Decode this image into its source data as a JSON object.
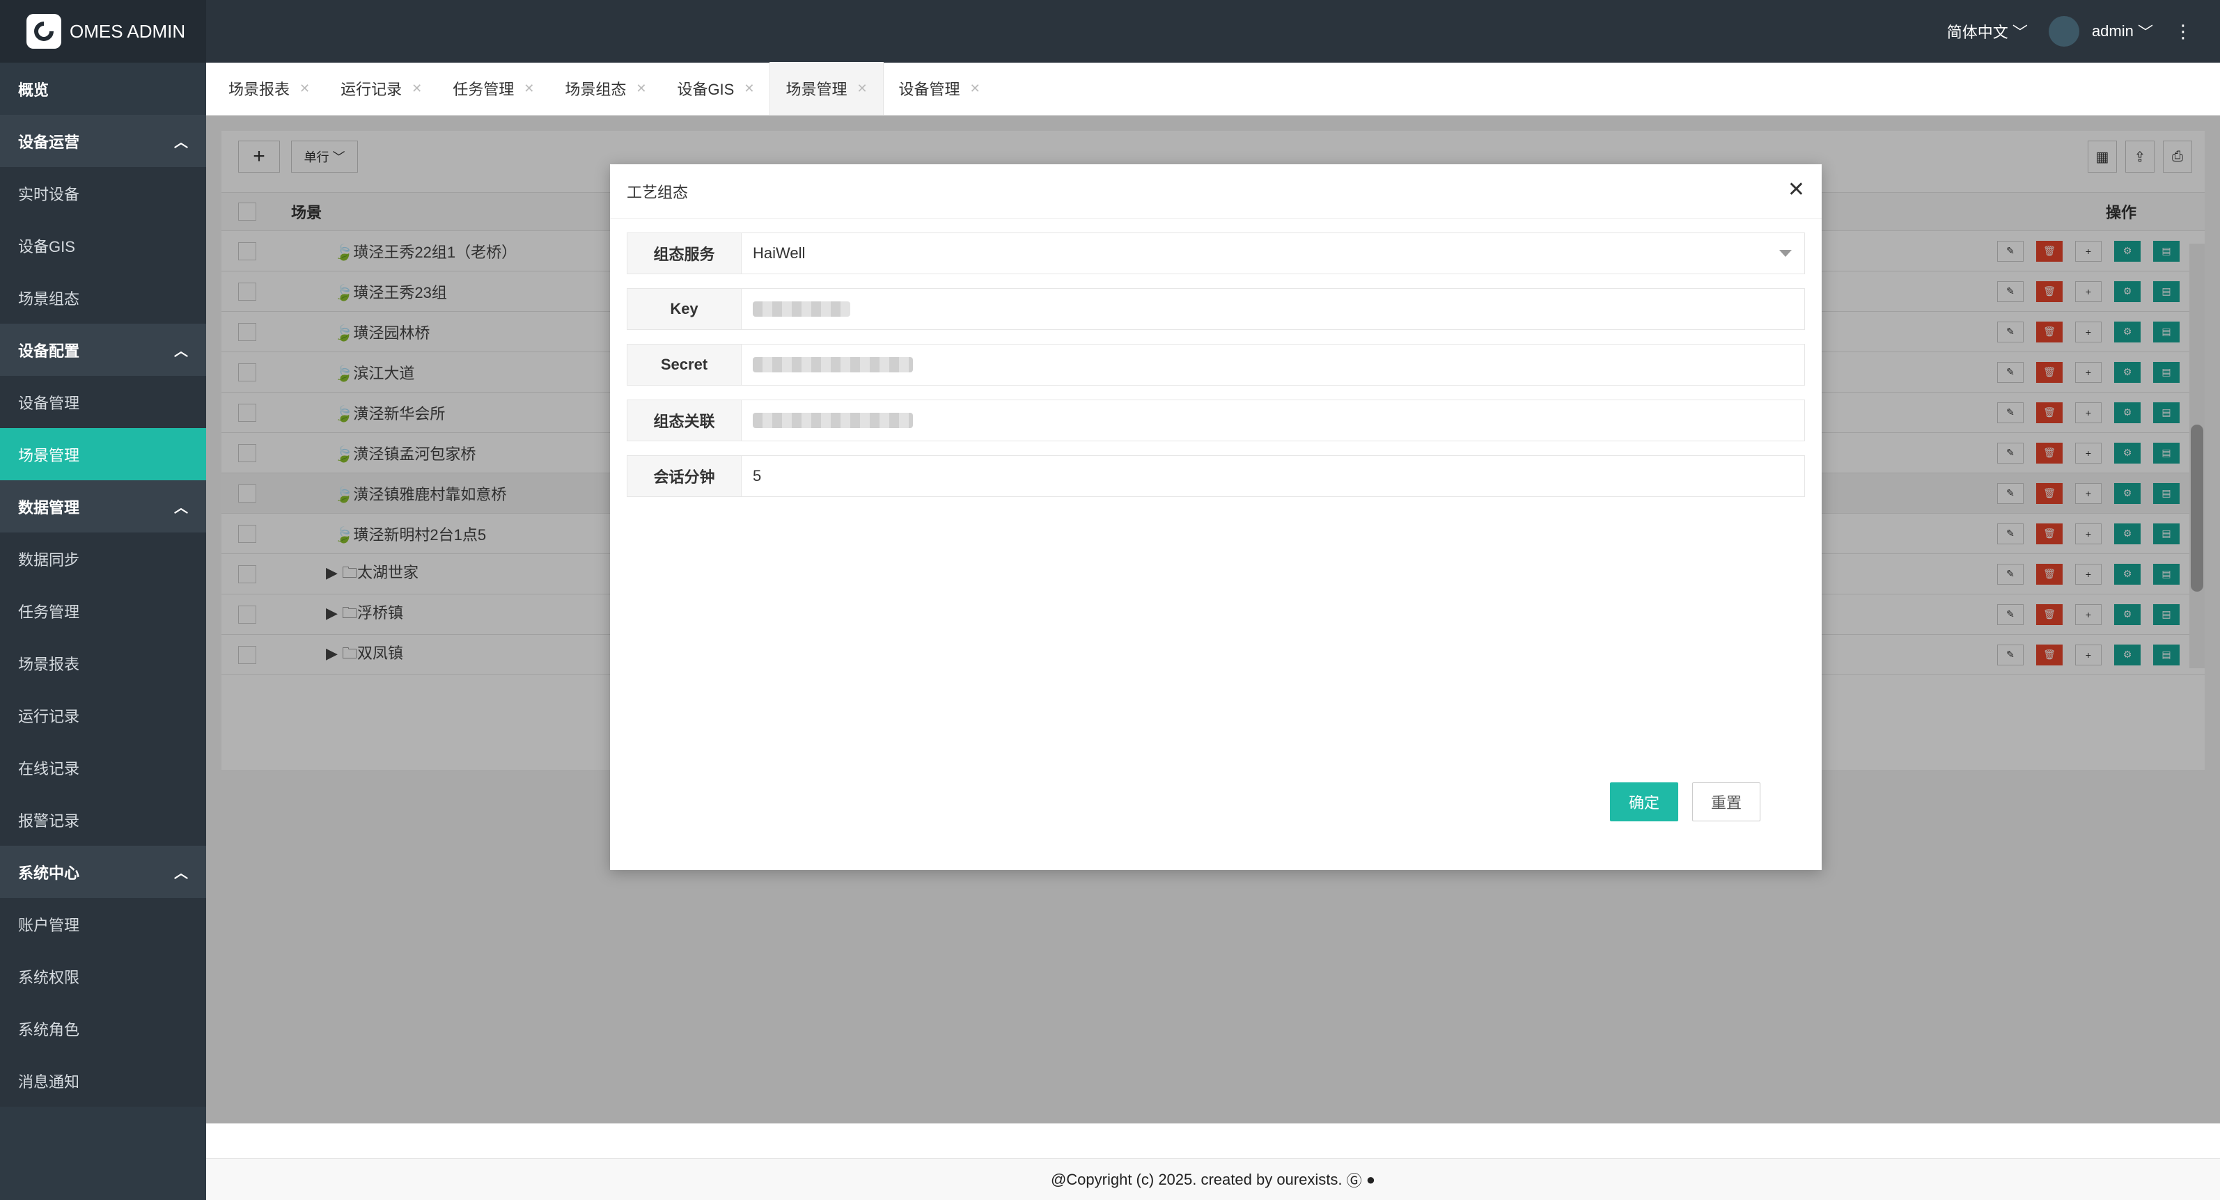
{
  "app": {
    "title": "OMES ADMIN"
  },
  "sidebar": {
    "items": [
      {
        "label": "概览",
        "kind": "top"
      },
      {
        "label": "设备运营",
        "kind": "group"
      },
      {
        "label": "实时设备",
        "kind": "item"
      },
      {
        "label": "设备GIS",
        "kind": "item"
      },
      {
        "label": "场景组态",
        "kind": "item"
      },
      {
        "label": "设备配置",
        "kind": "group"
      },
      {
        "label": "设备管理",
        "kind": "item"
      },
      {
        "label": "场景管理",
        "kind": "item",
        "active": true
      },
      {
        "label": "数据管理",
        "kind": "group"
      },
      {
        "label": "数据同步",
        "kind": "item"
      },
      {
        "label": "任务管理",
        "kind": "item"
      },
      {
        "label": "场景报表",
        "kind": "item"
      },
      {
        "label": "运行记录",
        "kind": "item"
      },
      {
        "label": "在线记录",
        "kind": "item"
      },
      {
        "label": "报警记录",
        "kind": "item"
      },
      {
        "label": "系统中心",
        "kind": "group"
      },
      {
        "label": "账户管理",
        "kind": "item"
      },
      {
        "label": "系统权限",
        "kind": "item"
      },
      {
        "label": "系统角色",
        "kind": "item"
      },
      {
        "label": "消息通知",
        "kind": "item"
      }
    ]
  },
  "header": {
    "language": "简体中文",
    "user": "admin"
  },
  "tabs": [
    {
      "label": "场景报表"
    },
    {
      "label": "运行记录"
    },
    {
      "label": "任务管理"
    },
    {
      "label": "场景组态"
    },
    {
      "label": "设备GIS"
    },
    {
      "label": "场景管理",
      "active": true
    },
    {
      "label": "设备管理"
    }
  ],
  "toolbar": {
    "add": "+",
    "single_row": "单行"
  },
  "table": {
    "col_scene": "场景",
    "col_ops": "操作",
    "rows": [
      {
        "name": "璜泾王秀22组1（老桥）",
        "folder": false
      },
      {
        "name": "璜泾王秀23组",
        "folder": false
      },
      {
        "name": "璜泾园林桥",
        "folder": false
      },
      {
        "name": "滨江大道",
        "folder": false
      },
      {
        "name": "潢泾新华会所",
        "folder": false
      },
      {
        "name": "潢泾镇孟河包家桥",
        "folder": false
      },
      {
        "name": "潢泾镇雅鹿村靠如意桥",
        "folder": false
      },
      {
        "name": "璜泾新明村2台1点5",
        "folder": false
      },
      {
        "name": "太湖世家",
        "folder": true
      },
      {
        "name": "浮桥镇",
        "folder": true
      },
      {
        "name": "双凤镇",
        "folder": true
      }
    ]
  },
  "modal": {
    "title": "工艺组态",
    "fields": [
      {
        "label": "组态服务",
        "value": "HaiWell"
      },
      {
        "label": "Key",
        "value": ""
      },
      {
        "label": "Secret",
        "value": ""
      },
      {
        "label": "组态关联",
        "value": ""
      },
      {
        "label": "会话分钟",
        "value": "5"
      }
    ],
    "confirm": "确定",
    "reset": "重置"
  },
  "footer": {
    "text": "@Copyright (c) 2025. created by ourexists."
  },
  "colors": {
    "accent": "#1fbaa6",
    "danger": "#e8462b",
    "sidebar": "#2f3a44"
  }
}
